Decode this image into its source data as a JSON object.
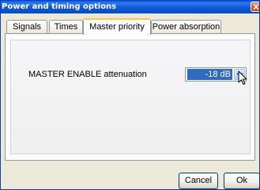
{
  "window": {
    "title": "Power and timing options"
  },
  "tabs": [
    {
      "label": "Signals",
      "active": false
    },
    {
      "label": "Times",
      "active": false
    },
    {
      "label": "Master priority",
      "active": true
    },
    {
      "label": "Power absorption",
      "active": false
    }
  ],
  "master_priority": {
    "attenuation_label": "MASTER ENABLE attenuation",
    "attenuation_value": "-18 dB"
  },
  "buttons": {
    "cancel_label": "Cancel",
    "ok_label": "Ok"
  },
  "colors": {
    "titlebar": "#0a5ce4",
    "selection": "#316ac5",
    "active_tab_accent": "#ffc83c",
    "close_button": "#c7391b"
  },
  "icons": {
    "close": "close-icon",
    "dropdown": "chevron-down-icon",
    "cursor": "mouse-pointer-icon"
  }
}
